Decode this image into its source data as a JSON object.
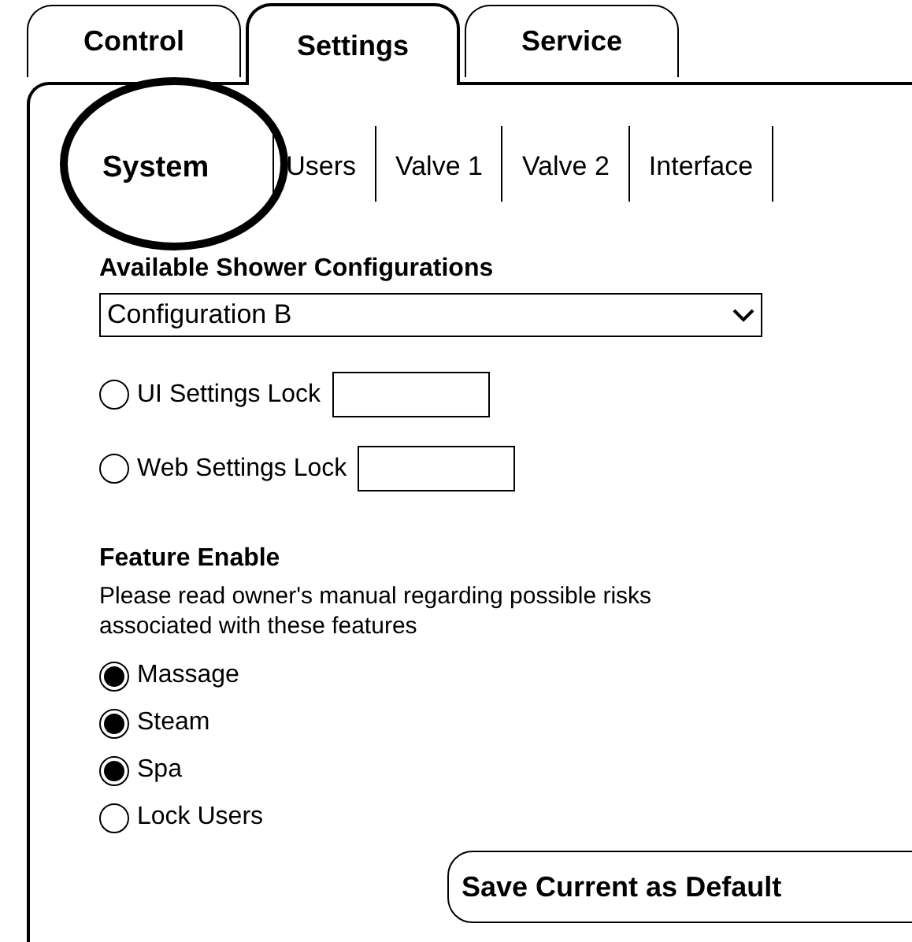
{
  "top_tabs": [
    {
      "label": "Control",
      "selected": false
    },
    {
      "label": "Settings",
      "selected": true
    },
    {
      "label": "Service",
      "selected": false
    }
  ],
  "sub_tabs": [
    {
      "label": "System",
      "selected": true,
      "circled": true
    },
    {
      "label": "Users",
      "selected": false,
      "circled": false
    },
    {
      "label": "Valve 1",
      "selected": false,
      "circled": false
    },
    {
      "label": "Valve 2",
      "selected": false,
      "circled": false
    },
    {
      "label": "Interface",
      "selected": false,
      "circled": false
    }
  ],
  "configurations": {
    "label": "Available Shower Configurations",
    "value": "Configuration B"
  },
  "locks": [
    {
      "label": "UI Settings Lock",
      "checked": false
    },
    {
      "label": "Web Settings Lock",
      "checked": false
    }
  ],
  "feature_enable": {
    "title": "Feature Enable",
    "note": "Please read owner's manual regarding possible risks associated with these features",
    "options": [
      {
        "label": "Massage",
        "checked": true
      },
      {
        "label": "Steam",
        "checked": true
      },
      {
        "label": "Spa",
        "checked": true
      },
      {
        "label": "Lock Users",
        "checked": false
      }
    ]
  },
  "save_button": "Save Current as Default"
}
